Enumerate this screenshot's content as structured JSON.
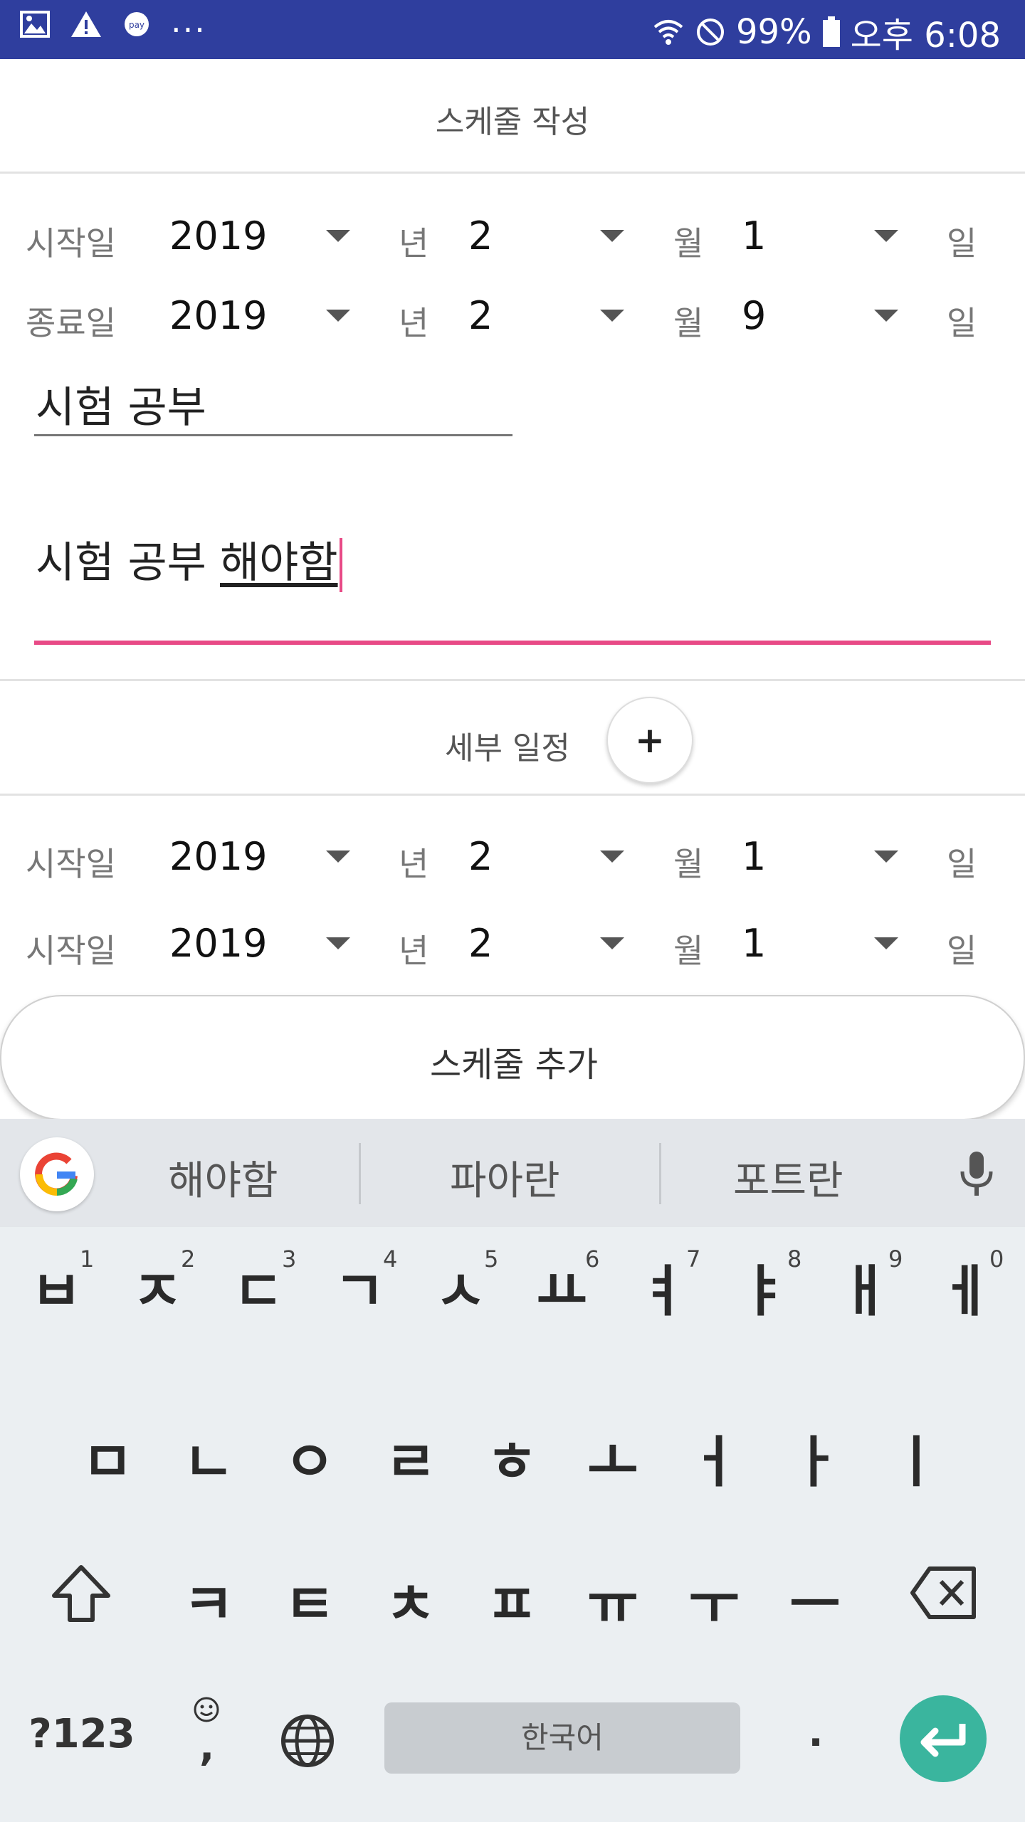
{
  "status_bar": {
    "battery": "99%",
    "time": "오후 6:08",
    "more": "..."
  },
  "header": {
    "title": "스케줄 작성"
  },
  "date_rows": [
    {
      "label": "시작일",
      "year": "2019",
      "year_unit": "년",
      "month": "2",
      "month_unit": "월",
      "day": "1",
      "day_unit": "일"
    },
    {
      "label": "종료일",
      "year": "2019",
      "year_unit": "년",
      "month": "2",
      "month_unit": "월",
      "day": "9",
      "day_unit": "일"
    }
  ],
  "title_input": {
    "value": "시험 공부"
  },
  "content_input": {
    "value_committed": "시험 공부 ",
    "value_composing": "해야함"
  },
  "sub_schedule": {
    "label": "세부 일정",
    "add_label": "+",
    "rows": [
      {
        "label": "시작일",
        "year": "2019",
        "year_unit": "년",
        "month": "2",
        "month_unit": "월",
        "day": "1",
        "day_unit": "일"
      },
      {
        "label": "시작일",
        "year": "2019",
        "year_unit": "년",
        "month": "2",
        "month_unit": "월",
        "day": "1",
        "day_unit": "일"
      }
    ]
  },
  "add_schedule_button": {
    "label": "스케줄 추가"
  },
  "keyboard": {
    "suggestions": [
      "해야함",
      "파아란",
      "포트란"
    ],
    "row1": [
      {
        "k": "ㅂ",
        "h": "1"
      },
      {
        "k": "ㅈ",
        "h": "2"
      },
      {
        "k": "ㄷ",
        "h": "3"
      },
      {
        "k": "ㄱ",
        "h": "4"
      },
      {
        "k": "ㅅ",
        "h": "5"
      },
      {
        "k": "ㅛ",
        "h": "6"
      },
      {
        "k": "ㅕ",
        "h": "7"
      },
      {
        "k": "ㅑ",
        "h": "8"
      },
      {
        "k": "ㅐ",
        "h": "9"
      },
      {
        "k": "ㅔ",
        "h": "0"
      }
    ],
    "row2": [
      "ㅁ",
      "ㄴ",
      "ㅇ",
      "ㄹ",
      "ㅎ",
      "ㅗ",
      "ㅓ",
      "ㅏ",
      "ㅣ"
    ],
    "row3": [
      "ㅋ",
      "ㅌ",
      "ㅊ",
      "ㅍ",
      "ㅠ",
      "ㅜ",
      "ㅡ"
    ],
    "symbols_label": "?123",
    "comma_label": ",",
    "space_label": "한국어",
    "period_label": ".",
    "accent_color": "#3ab59e"
  }
}
